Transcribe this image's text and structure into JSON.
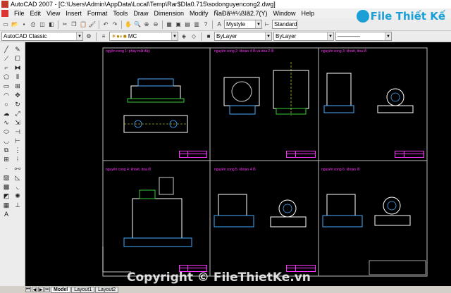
{
  "window": {
    "title": "AutoCAD 2007 - [C:\\Users\\Admin\\AppData\\Local\\Temp\\Rar$DIa0.715\\sodonguyencong2.dwg]"
  },
  "menu": [
    "File",
    "Edit",
    "View",
    "Insert",
    "Format",
    "Tools",
    "Draw",
    "Dimension",
    "Modify",
    "ÑaÐã¹#¼ßIã2.7(Y)",
    "Window",
    "Help"
  ],
  "toolbar": {
    "workspace": "AutoCAD Classic",
    "layer": "MC",
    "text_style": "Mystyle",
    "dim_style": "Standard",
    "color": "ByLayer",
    "linetype": "ByLayer"
  },
  "sheets": [
    {
      "title": "ngyên cong 1: phay mặt đáy"
    },
    {
      "title": "nguyên cong 2: khoan 4 lỗ và doa 2 lỗ"
    },
    {
      "title": "nguyên cong 3: khoét, doa lỗ"
    },
    {
      "title": "nguyên cong 4: khoét, doa lỗ"
    },
    {
      "title": "nguyên cong 5: khoan 4 lỗ"
    },
    {
      "title": "nguyên cong 6: khoan lỗ"
    }
  ],
  "tabs": [
    "Model",
    "Layout1",
    "Layout2"
  ],
  "active_tab": "Model",
  "watermark": {
    "logo": "File Thiết Kế",
    "copyright": "Copyright © FileThietKe.vn"
  },
  "colors": {
    "canvas": "#000000",
    "drawing_magenta": "#ff33ff",
    "accent_blue": "#1a9fd6"
  }
}
